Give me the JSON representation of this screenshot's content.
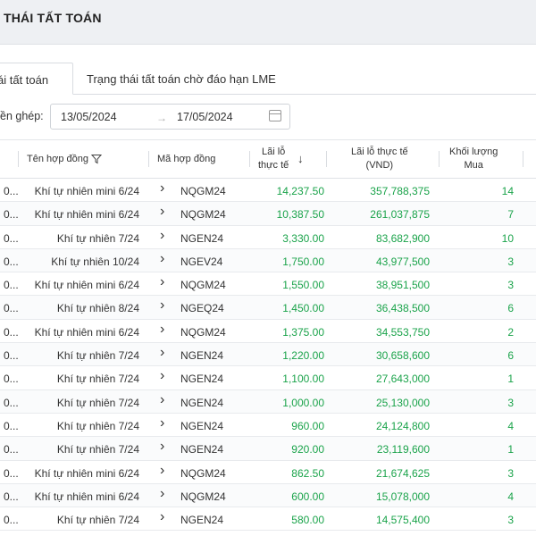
{
  "header": {
    "title": "THÁI TẤT TOÁN"
  },
  "tabs": [
    {
      "label": "ái tất toán",
      "active": true
    },
    {
      "label": "Trạng thái tất toán chờ đáo hạn LME",
      "active": false
    }
  ],
  "filter": {
    "label": "ền ghép:",
    "from_date": "13/05/2024",
    "to_date": "17/05/2024",
    "arrow": "→"
  },
  "columns": {
    "name": "Tên hợp đồng",
    "code": "Mã hợp đồng",
    "pnl_line1": "Lãi lỗ",
    "pnl_line2": "thực tế",
    "vnd_line1": "Lãi lỗ thực tế",
    "vnd_line2": "(VND)",
    "vol_line1": "Khối lượng",
    "vol_line2": "Mua"
  },
  "colors": {
    "positive": "#1aa34a",
    "header_bg": "#eef0f3"
  },
  "rows": [
    {
      "date": "0...",
      "name": "Khí tự nhiên mini 6/24",
      "code": "NQGM24",
      "pnl": "14,237.50",
      "vnd": "357,788,375",
      "vol": "14"
    },
    {
      "date": "0...",
      "name": "Khí tự nhiên mini 6/24",
      "code": "NQGM24",
      "pnl": "10,387.50",
      "vnd": "261,037,875",
      "vol": "7"
    },
    {
      "date": "0...",
      "name": "Khí tự nhiên 7/24",
      "code": "NGEN24",
      "pnl": "3,330.00",
      "vnd": "83,682,900",
      "vol": "10"
    },
    {
      "date": "0...",
      "name": "Khí tự nhiên 10/24",
      "code": "NGEV24",
      "pnl": "1,750.00",
      "vnd": "43,977,500",
      "vol": "3"
    },
    {
      "date": "0...",
      "name": "Khí tự nhiên mini 6/24",
      "code": "NQGM24",
      "pnl": "1,550.00",
      "vnd": "38,951,500",
      "vol": "3"
    },
    {
      "date": "0...",
      "name": "Khí tự nhiên 8/24",
      "code": "NGEQ24",
      "pnl": "1,450.00",
      "vnd": "36,438,500",
      "vol": "6"
    },
    {
      "date": "0...",
      "name": "Khí tự nhiên mini 6/24",
      "code": "NQGM24",
      "pnl": "1,375.00",
      "vnd": "34,553,750",
      "vol": "2"
    },
    {
      "date": "0...",
      "name": "Khí tự nhiên 7/24",
      "code": "NGEN24",
      "pnl": "1,220.00",
      "vnd": "30,658,600",
      "vol": "6"
    },
    {
      "date": "0...",
      "name": "Khí tự nhiên 7/24",
      "code": "NGEN24",
      "pnl": "1,100.00",
      "vnd": "27,643,000",
      "vol": "1"
    },
    {
      "date": "0...",
      "name": "Khí tự nhiên 7/24",
      "code": "NGEN24",
      "pnl": "1,000.00",
      "vnd": "25,130,000",
      "vol": "3"
    },
    {
      "date": "0...",
      "name": "Khí tự nhiên 7/24",
      "code": "NGEN24",
      "pnl": "960.00",
      "vnd": "24,124,800",
      "vol": "4"
    },
    {
      "date": "0...",
      "name": "Khí tự nhiên 7/24",
      "code": "NGEN24",
      "pnl": "920.00",
      "vnd": "23,119,600",
      "vol": "1"
    },
    {
      "date": "0...",
      "name": "Khí tự nhiên mini 6/24",
      "code": "NQGM24",
      "pnl": "862.50",
      "vnd": "21,674,625",
      "vol": "3"
    },
    {
      "date": "0...",
      "name": "Khí tự nhiên mini 6/24",
      "code": "NQGM24",
      "pnl": "600.00",
      "vnd": "15,078,000",
      "vol": "4"
    },
    {
      "date": "0...",
      "name": "Khí tự nhiên 7/24",
      "code": "NGEN24",
      "pnl": "580.00",
      "vnd": "14,575,400",
      "vol": "3"
    }
  ]
}
